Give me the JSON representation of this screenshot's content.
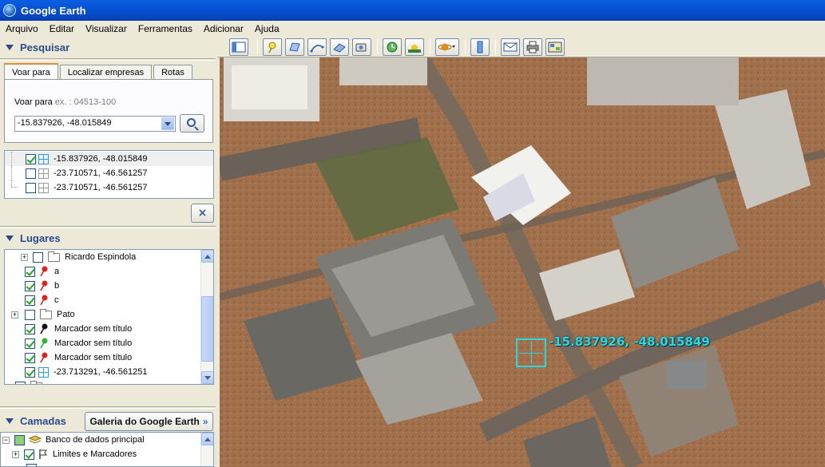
{
  "window": {
    "title": "Google Earth"
  },
  "menu": [
    "Arquivo",
    "Editar",
    "Visualizar",
    "Ferramentas",
    "Adicionar",
    "Ajuda"
  ],
  "search_panel": {
    "header": "Pesquisar",
    "tabs": [
      "Voar para",
      "Localizar empresas",
      "Rotas"
    ],
    "active_tab": "Voar para",
    "fly_label": "Voar para",
    "fly_hint": "ex. : 04513-100",
    "fly_value": "-15.837926, -48.015849",
    "results": [
      {
        "label": "-15.837926, -48.015849",
        "checked": true,
        "selected": true
      },
      {
        "label": "-23.710571, -46.561257",
        "checked": false
      },
      {
        "label": "-23.710571, -46.561257",
        "checked": false
      }
    ],
    "close_label": "×"
  },
  "places_panel": {
    "header": "Lugares",
    "items": [
      {
        "label": "Ricardo Espindola",
        "type": "folder",
        "checked": false
      },
      {
        "label": "a",
        "type": "pin-red",
        "checked": true
      },
      {
        "label": "b",
        "type": "pin-red",
        "checked": true
      },
      {
        "label": "c",
        "type": "pin-red",
        "checked": true
      },
      {
        "label": "Pato",
        "type": "folder",
        "checked": false
      },
      {
        "label": "Marcador sem título",
        "type": "pin-black",
        "checked": true
      },
      {
        "label": "Marcador sem título",
        "type": "pin-green",
        "checked": true
      },
      {
        "label": "Marcador sem título",
        "type": "pin-red",
        "checked": true
      },
      {
        "label": "-23.713291, -46.561251",
        "type": "grid",
        "checked": true
      }
    ]
  },
  "layers_panel": {
    "header": "Camadas",
    "gallery_button": "Galeria do Google Earth",
    "gallery_chevron": "»",
    "items": [
      {
        "label": "Banco de dados principal"
      },
      {
        "label": "Limites e Marcadores"
      }
    ]
  },
  "map": {
    "placemark_label": "-15.837926, -48.015849",
    "label_color": "#2fd6e0"
  },
  "colors": {
    "titlebar": "#0752d6",
    "panel_header": "#2a4b8d",
    "tab_accent": "#e68b2c"
  }
}
